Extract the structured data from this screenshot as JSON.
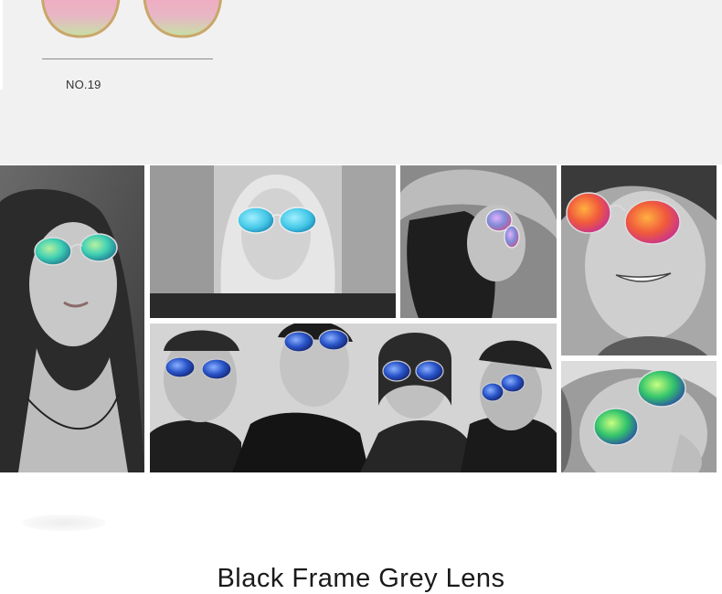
{
  "product": {
    "number_label": "NO.19",
    "lens_colors": [
      "#f3a7c2",
      "#c7e1a4"
    ],
    "frame_color": "#c9a76a"
  },
  "collage": {
    "photos": [
      {
        "name": "photo-woman-looking-up",
        "lens_color": "#3fd0b4"
      },
      {
        "name": "photo-blonde-woman",
        "lens_color": "#41c6e6"
      },
      {
        "name": "photo-woman-hat",
        "lens_color": "#7f8bd6"
      },
      {
        "name": "photo-man-smiling",
        "lens_color": "#f05a3c"
      },
      {
        "name": "photo-group-of-four",
        "lens_color": "#2a55c9"
      },
      {
        "name": "photo-woman-closeup",
        "lens_color": "#33c46b"
      }
    ]
  },
  "caption": {
    "text": "Black Frame Grey Lens"
  }
}
